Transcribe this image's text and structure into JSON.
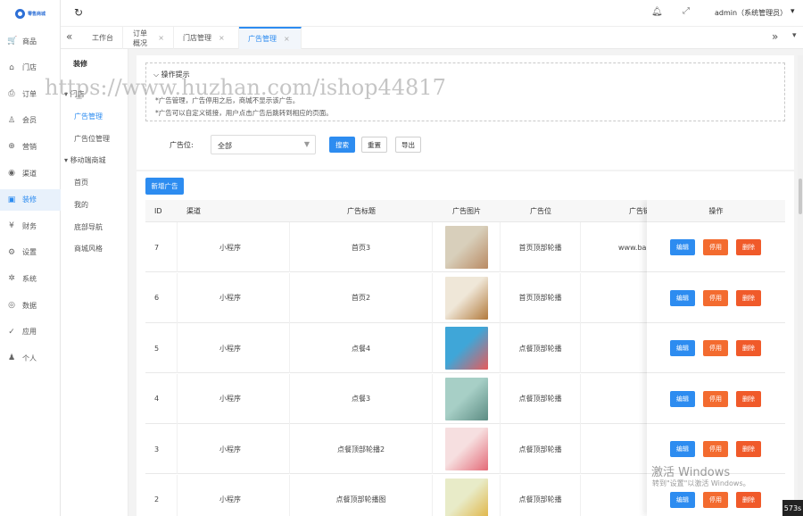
{
  "brand": {
    "logo_text": "零售商城"
  },
  "left_nav": [
    {
      "icon": "cart-icon",
      "glyph": "🛒",
      "label": "商品"
    },
    {
      "icon": "home-icon",
      "glyph": "⌂",
      "label": "门店"
    },
    {
      "icon": "order-icon",
      "glyph": "⎙",
      "label": "订单"
    },
    {
      "icon": "user-icon",
      "glyph": "♙",
      "label": "会员"
    },
    {
      "icon": "marketing-icon",
      "glyph": "⊕",
      "label": "营销"
    },
    {
      "icon": "channel-icon",
      "glyph": "◉",
      "label": "渠道"
    },
    {
      "icon": "decorate-icon",
      "glyph": "▣",
      "label": "装修",
      "active": true
    },
    {
      "icon": "finance-icon",
      "glyph": "¥",
      "label": "财务"
    },
    {
      "icon": "settings-icon",
      "glyph": "⚙",
      "label": "设置"
    },
    {
      "icon": "system-icon",
      "glyph": "✲",
      "label": "系统"
    },
    {
      "icon": "data-icon",
      "glyph": "◎",
      "label": "数据"
    },
    {
      "icon": "app-icon",
      "glyph": "✓",
      "label": "应用"
    },
    {
      "icon": "person-icon",
      "glyph": "♟",
      "label": "个人"
    }
  ],
  "sub_nav": {
    "title": "装修",
    "group1": "门店",
    "items1": [
      "广告管理",
      "广告位管理"
    ],
    "group2": "移动端商城",
    "items2": [
      "首页",
      "我的",
      "底部导航",
      "商城风格"
    ]
  },
  "topbar": {
    "user": "admin（系统管理员）"
  },
  "tabs": [
    {
      "label": "工作台",
      "closable": false
    },
    {
      "label": "订单概况",
      "closable": true
    },
    {
      "label": "门店管理",
      "closable": true
    },
    {
      "label": "广告管理",
      "closable": true,
      "active": true
    }
  ],
  "tips": {
    "title": "操作提示",
    "lines": [
      "*广告管理，广告停用之后，商城不显示该广告。",
      "*广告可以自定义链接，用户点击广告后跳转到相应的页面。"
    ]
  },
  "filter": {
    "label": "广告位:",
    "value": "全部",
    "search": "搜索",
    "reset": "重置",
    "export": "导出"
  },
  "actions": {
    "add": "新增广告"
  },
  "table": {
    "headers": [
      "ID",
      "渠道",
      "广告标题",
      "广告图片",
      "广告位",
      "广告链接",
      "操作"
    ],
    "op_labels": {
      "edit": "编辑",
      "stop": "停用",
      "delete": "删除"
    },
    "rows": [
      {
        "id": "7",
        "channel": "小程序",
        "title": "首页3",
        "position": "首页顶部轮播",
        "link": "www.ba",
        "image_colors": [
          "#d8cfbb",
          "#b98a63"
        ]
      },
      {
        "id": "6",
        "channel": "小程序",
        "title": "首页2",
        "position": "首页顶部轮播",
        "link": "",
        "image_colors": [
          "#efe7d8",
          "#b27a3c"
        ]
      },
      {
        "id": "5",
        "channel": "小程序",
        "title": "点餐4",
        "position": "点餐顶部轮播",
        "link": "",
        "image_colors": [
          "#3fa6d8",
          "#e85a5a"
        ]
      },
      {
        "id": "4",
        "channel": "小程序",
        "title": "点餐3",
        "position": "点餐顶部轮播",
        "link": "",
        "image_colors": [
          "#a7cfc6",
          "#5c8c83"
        ]
      },
      {
        "id": "3",
        "channel": "小程序",
        "title": "点餐顶部轮播2",
        "position": "点餐顶部轮播",
        "link": "",
        "image_colors": [
          "#f6dfe0",
          "#e46a77"
        ]
      },
      {
        "id": "2",
        "channel": "小程序",
        "title": "点餐顶部轮播图",
        "position": "点餐顶部轮播",
        "link": "",
        "image_colors": [
          "#e8ebc8",
          "#e0b23e"
        ]
      }
    ]
  },
  "watermark": {
    "text": "https://www.huzhan.com/ishop44817"
  },
  "windows": {
    "line1": "激活 Windows",
    "line2": "转到\"设置\"以激活 Windows。"
  },
  "corner": "573s"
}
